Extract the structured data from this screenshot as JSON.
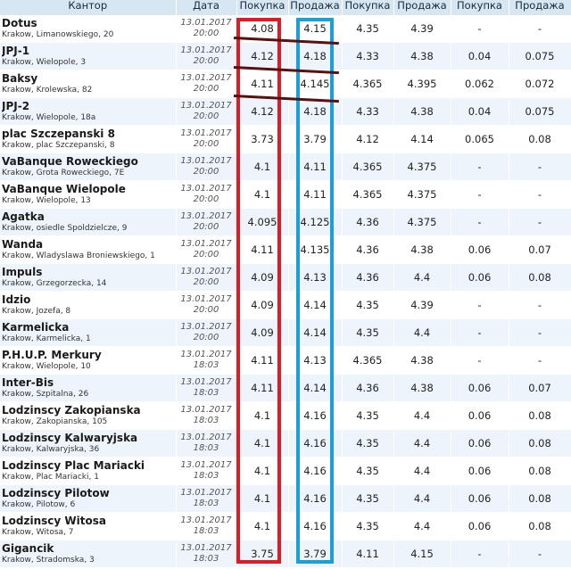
{
  "header": {
    "kantor": "Кантор",
    "data": "Дата",
    "pokupka1": "Покупка",
    "prodazha1": "Продажа",
    "pokupka2": "Покупка",
    "prodazha2": "Продажа",
    "pokupka3": "Покупка",
    "prodazha3": "Продажа"
  },
  "rows": [
    {
      "name": "Dotus",
      "addr": "Krakow, Limanowskiego, 20",
      "date": "13.01.2017",
      "time": "20:00",
      "b1": "4.08",
      "s1": "4.15",
      "b2": "4.35",
      "s2": "4.39",
      "b3": "-",
      "s3": "-"
    },
    {
      "name": "JPJ-1",
      "addr": "Krakow, Wielopole, 3",
      "date": "13.01.2017",
      "time": "20:00",
      "b1": "4.12",
      "s1": "4.18",
      "b2": "4.33",
      "s2": "4.38",
      "b3": "0.04",
      "s3": "0.075"
    },
    {
      "name": "Baksy",
      "addr": "Krakow, Krolewska, 82",
      "date": "13.01.2017",
      "time": "20:00",
      "b1": "4.11",
      "s1": "4.145",
      "b2": "4.365",
      "s2": "4.395",
      "b3": "0.062",
      "s3": "0.072"
    },
    {
      "name": "JPJ-2",
      "addr": "Krakow, Wielopole, 18a",
      "date": "13.01.2017",
      "time": "20:00",
      "b1": "4.12",
      "s1": "4.18",
      "b2": "4.33",
      "s2": "4.38",
      "b3": "0.04",
      "s3": "0.075"
    },
    {
      "name": "plac Szczepanski 8",
      "addr": "Krakow, plac Szczepanski, 8",
      "date": "13.01.2017",
      "time": "20:00",
      "b1": "3.73",
      "s1": "3.79",
      "b2": "4.12",
      "s2": "4.14",
      "b3": "0.065",
      "s3": "0.08"
    },
    {
      "name": "VaBanque Roweckiego",
      "addr": "Krakow, Grota Roweckiego, 7E",
      "date": "13.01.2017",
      "time": "20:00",
      "b1": "4.1",
      "s1": "4.11",
      "b2": "4.365",
      "s2": "4.375",
      "b3": "-",
      "s3": "-"
    },
    {
      "name": "VaBanque Wielopole",
      "addr": "Krakow, Wielopole, 13",
      "date": "13.01.2017",
      "time": "20:00",
      "b1": "4.1",
      "s1": "4.11",
      "b2": "4.365",
      "s2": "4.375",
      "b3": "-",
      "s3": "-"
    },
    {
      "name": "Agatka",
      "addr": "Krakow, osiedle Spoldzielcze, 9",
      "date": "13.01.2017",
      "time": "20:00",
      "b1": "4.095",
      "s1": "4.125",
      "b2": "4.36",
      "s2": "4.375",
      "b3": "-",
      "s3": "-"
    },
    {
      "name": "Wanda",
      "addr": "Krakow, Wladyslawa Broniewskiego, 1",
      "date": "13.01.2017",
      "time": "20:00",
      "b1": "4.11",
      "s1": "4.135",
      "b2": "4.36",
      "s2": "4.38",
      "b3": "0.06",
      "s3": "0.07"
    },
    {
      "name": "Impuls",
      "addr": "Krakow, Grzegorzecka, 14",
      "date": "13.01.2017",
      "time": "20:00",
      "b1": "4.09",
      "s1": "4.13",
      "b2": "4.36",
      "s2": "4.4",
      "b3": "0.06",
      "s3": "0.08"
    },
    {
      "name": "Idzio",
      "addr": "Krakow, Jozefa, 8",
      "date": "13.01.2017",
      "time": "20:00",
      "b1": "4.09",
      "s1": "4.14",
      "b2": "4.35",
      "s2": "4.39",
      "b3": "-",
      "s3": "-"
    },
    {
      "name": "Karmelicka",
      "addr": "Krakow, Karmelicka, 1",
      "date": "13.01.2017",
      "time": "20:00",
      "b1": "4.09",
      "s1": "4.14",
      "b2": "4.35",
      "s2": "4.4",
      "b3": "-",
      "s3": "-"
    },
    {
      "name": "P.H.U.P. Merkury",
      "addr": "Krakow, Wielopole, 10",
      "date": "13.01.2017",
      "time": "18:03",
      "b1": "4.11",
      "s1": "4.13",
      "b2": "4.365",
      "s2": "4.38",
      "b3": "-",
      "s3": "-"
    },
    {
      "name": "Inter-Bis",
      "addr": "Krakow, Szpitalna, 26",
      "date": "13.01.2017",
      "time": "18:03",
      "b1": "4.11",
      "s1": "4.14",
      "b2": "4.36",
      "s2": "4.38",
      "b3": "0.06",
      "s3": "0.07"
    },
    {
      "name": "Lodzinscy Zakopianska",
      "addr": "Krakow, Zakopianska, 105",
      "date": "13.01.2017",
      "time": "18:03",
      "b1": "4.1",
      "s1": "4.16",
      "b2": "4.35",
      "s2": "4.4",
      "b3": "0.06",
      "s3": "0.08"
    },
    {
      "name": "Lodzinscy Kalwaryjska",
      "addr": "Krakow, Kalwaryjska, 36",
      "date": "13.01.2017",
      "time": "18:03",
      "b1": "4.1",
      "s1": "4.16",
      "b2": "4.35",
      "s2": "4.4",
      "b3": "0.06",
      "s3": "0.08"
    },
    {
      "name": "Lodzinscy Plac Mariacki",
      "addr": "Krakow, Plac Mariacki, 1",
      "date": "13.01.2017",
      "time": "18:03",
      "b1": "4.1",
      "s1": "4.16",
      "b2": "4.35",
      "s2": "4.4",
      "b3": "0.06",
      "s3": "0.08"
    },
    {
      "name": "Lodzinscy Pilotow",
      "addr": "Krakow, Pilotow, 6",
      "date": "13.01.2017",
      "time": "18:03",
      "b1": "4.1",
      "s1": "4.16",
      "b2": "4.35",
      "s2": "4.4",
      "b3": "0.06",
      "s3": "0.08"
    },
    {
      "name": "Lodzinscy Witosa",
      "addr": "Krakow, Witosa, 7",
      "date": "13.01.2017",
      "time": "18:03",
      "b1": "4.1",
      "s1": "4.16",
      "b2": "4.35",
      "s2": "4.4",
      "b3": "0.06",
      "s3": "0.08"
    },
    {
      "name": "Gigancik",
      "addr": "Krakow, Stradomska, 3",
      "date": "13.01.2017",
      "time": "18:03",
      "b1": "3.75",
      "s1": "3.79",
      "b2": "4.11",
      "s2": "4.15",
      "b3": "-",
      "s3": "-"
    }
  ],
  "annotation_colors": {
    "red_box": "#e01b24",
    "blue_box": "#1aa0d8",
    "strike_lines": "#5a1010"
  }
}
